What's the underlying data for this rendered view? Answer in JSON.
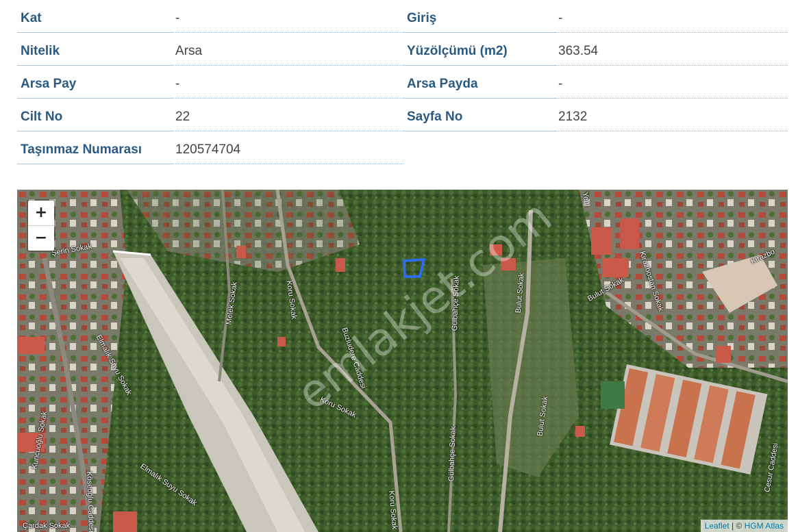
{
  "property_info": {
    "rows": [
      {
        "label_left": "Kat",
        "value_left": "-",
        "label_right": "Giriş",
        "value_right": "-"
      },
      {
        "label_left": "Nitelik",
        "value_left": "Arsa",
        "label_right": "Yüzölçümü (m2)",
        "value_right": "363.54"
      },
      {
        "label_left": "Arsa Pay",
        "value_left": "-",
        "label_right": "Arsa Payda",
        "value_right": "-"
      },
      {
        "label_left": "Cilt No",
        "value_left": "22",
        "label_right": "Sayfa No",
        "value_right": "2132"
      },
      {
        "label_left": "Taşınmaz Numarası",
        "value_left": "120574704"
      }
    ]
  },
  "map": {
    "zoom_in": "+",
    "zoom_out": "−",
    "watermark": "emlakjet.com",
    "attribution_leaflet": "Leaflet",
    "attribution_sep": " | © ",
    "attribution_hgm": "HGM Atlas",
    "parcel_color": "#2b6cff",
    "streets": [
      "Şerin Sokak",
      "Melek Sokak",
      "Koru Sokak",
      "Buzludere Caddesi",
      "Gülbahçe Sokak",
      "Bulut Sokak",
      "Bulut Sokak",
      "Kirazbostan Sokak",
      "Elmalık Suyu Sokak",
      "Koru Sokak",
      "Gülbahçe Sokak",
      "Bulut Sokak",
      "Köseoğlu Caddesi",
      "Elmalık Suyu Sokak",
      "Koru Sokak",
      "Çardak Sokak",
      "Cesur Caddesi",
      "Kuncuoğlu Sokak",
      "Yeni",
      "Kirazbo"
    ]
  }
}
